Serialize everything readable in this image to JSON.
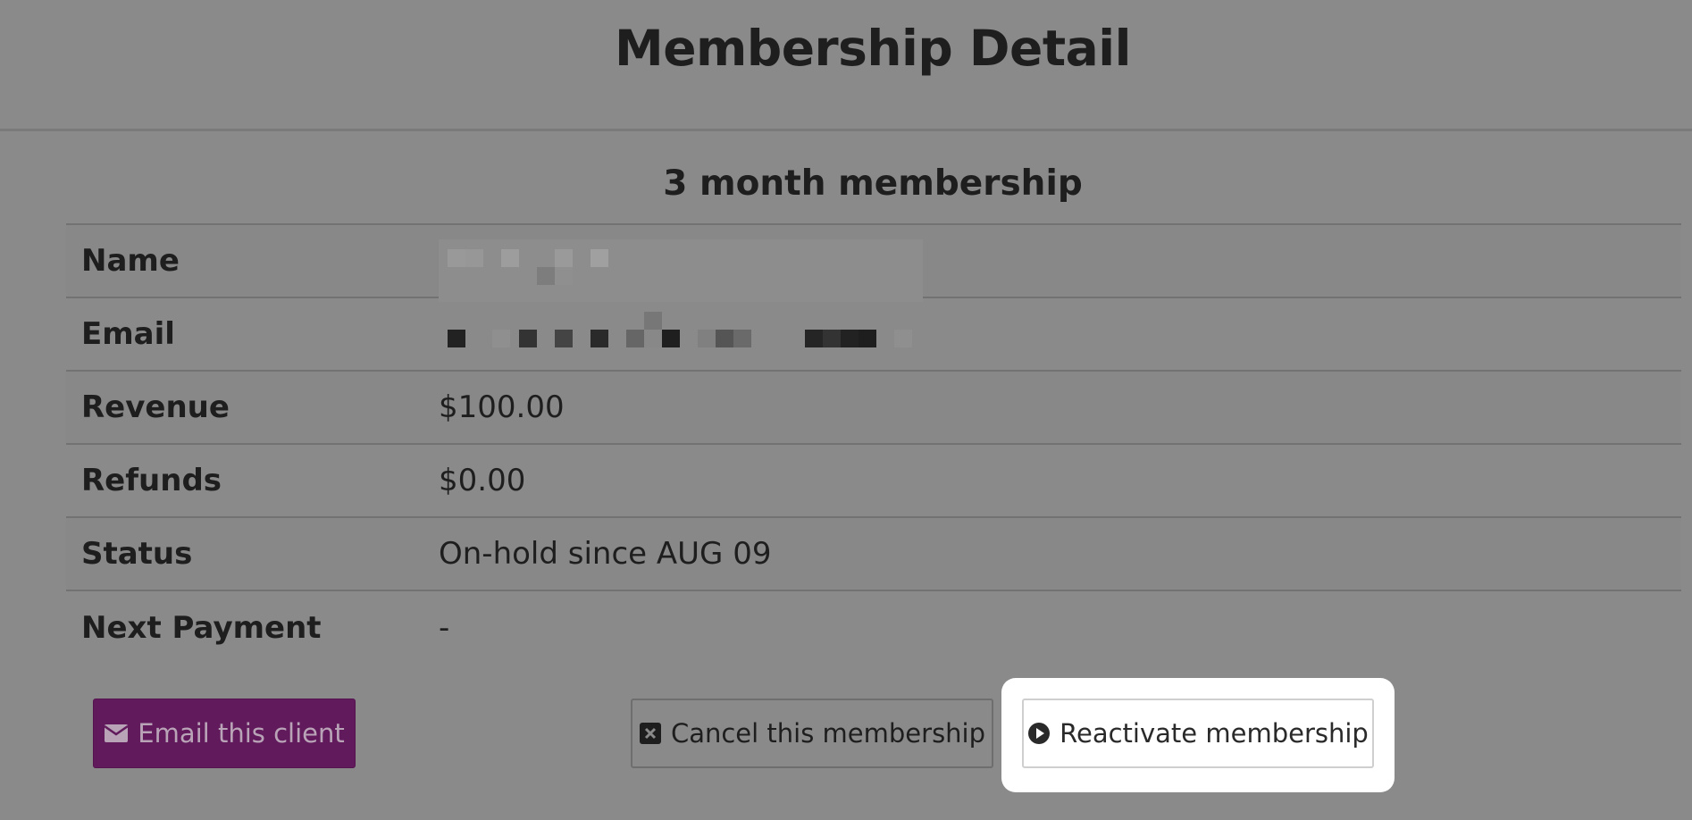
{
  "page": {
    "title": "Membership Detail"
  },
  "membership": {
    "title": "3 month membership",
    "rows": [
      {
        "label": "Name",
        "value": ""
      },
      {
        "label": "Email",
        "value": ""
      },
      {
        "label": "Revenue",
        "value": "$100.00"
      },
      {
        "label": "Refunds",
        "value": "$0.00"
      },
      {
        "label": "Status",
        "value": "On-hold since AUG 09"
      },
      {
        "label": "Next Payment",
        "value": "-"
      }
    ]
  },
  "actions": {
    "email_label": "Email this client",
    "email_icon": "envelope-icon",
    "cancel_label": "Cancel this membership",
    "cancel_icon": "close-square-icon",
    "reactivate_label": "Reactivate membership",
    "reactivate_icon": "play-circle-icon"
  },
  "colors": {
    "brand": "#611a5c",
    "overlay": "#8a8a8a",
    "highlight": "#ffffff"
  }
}
